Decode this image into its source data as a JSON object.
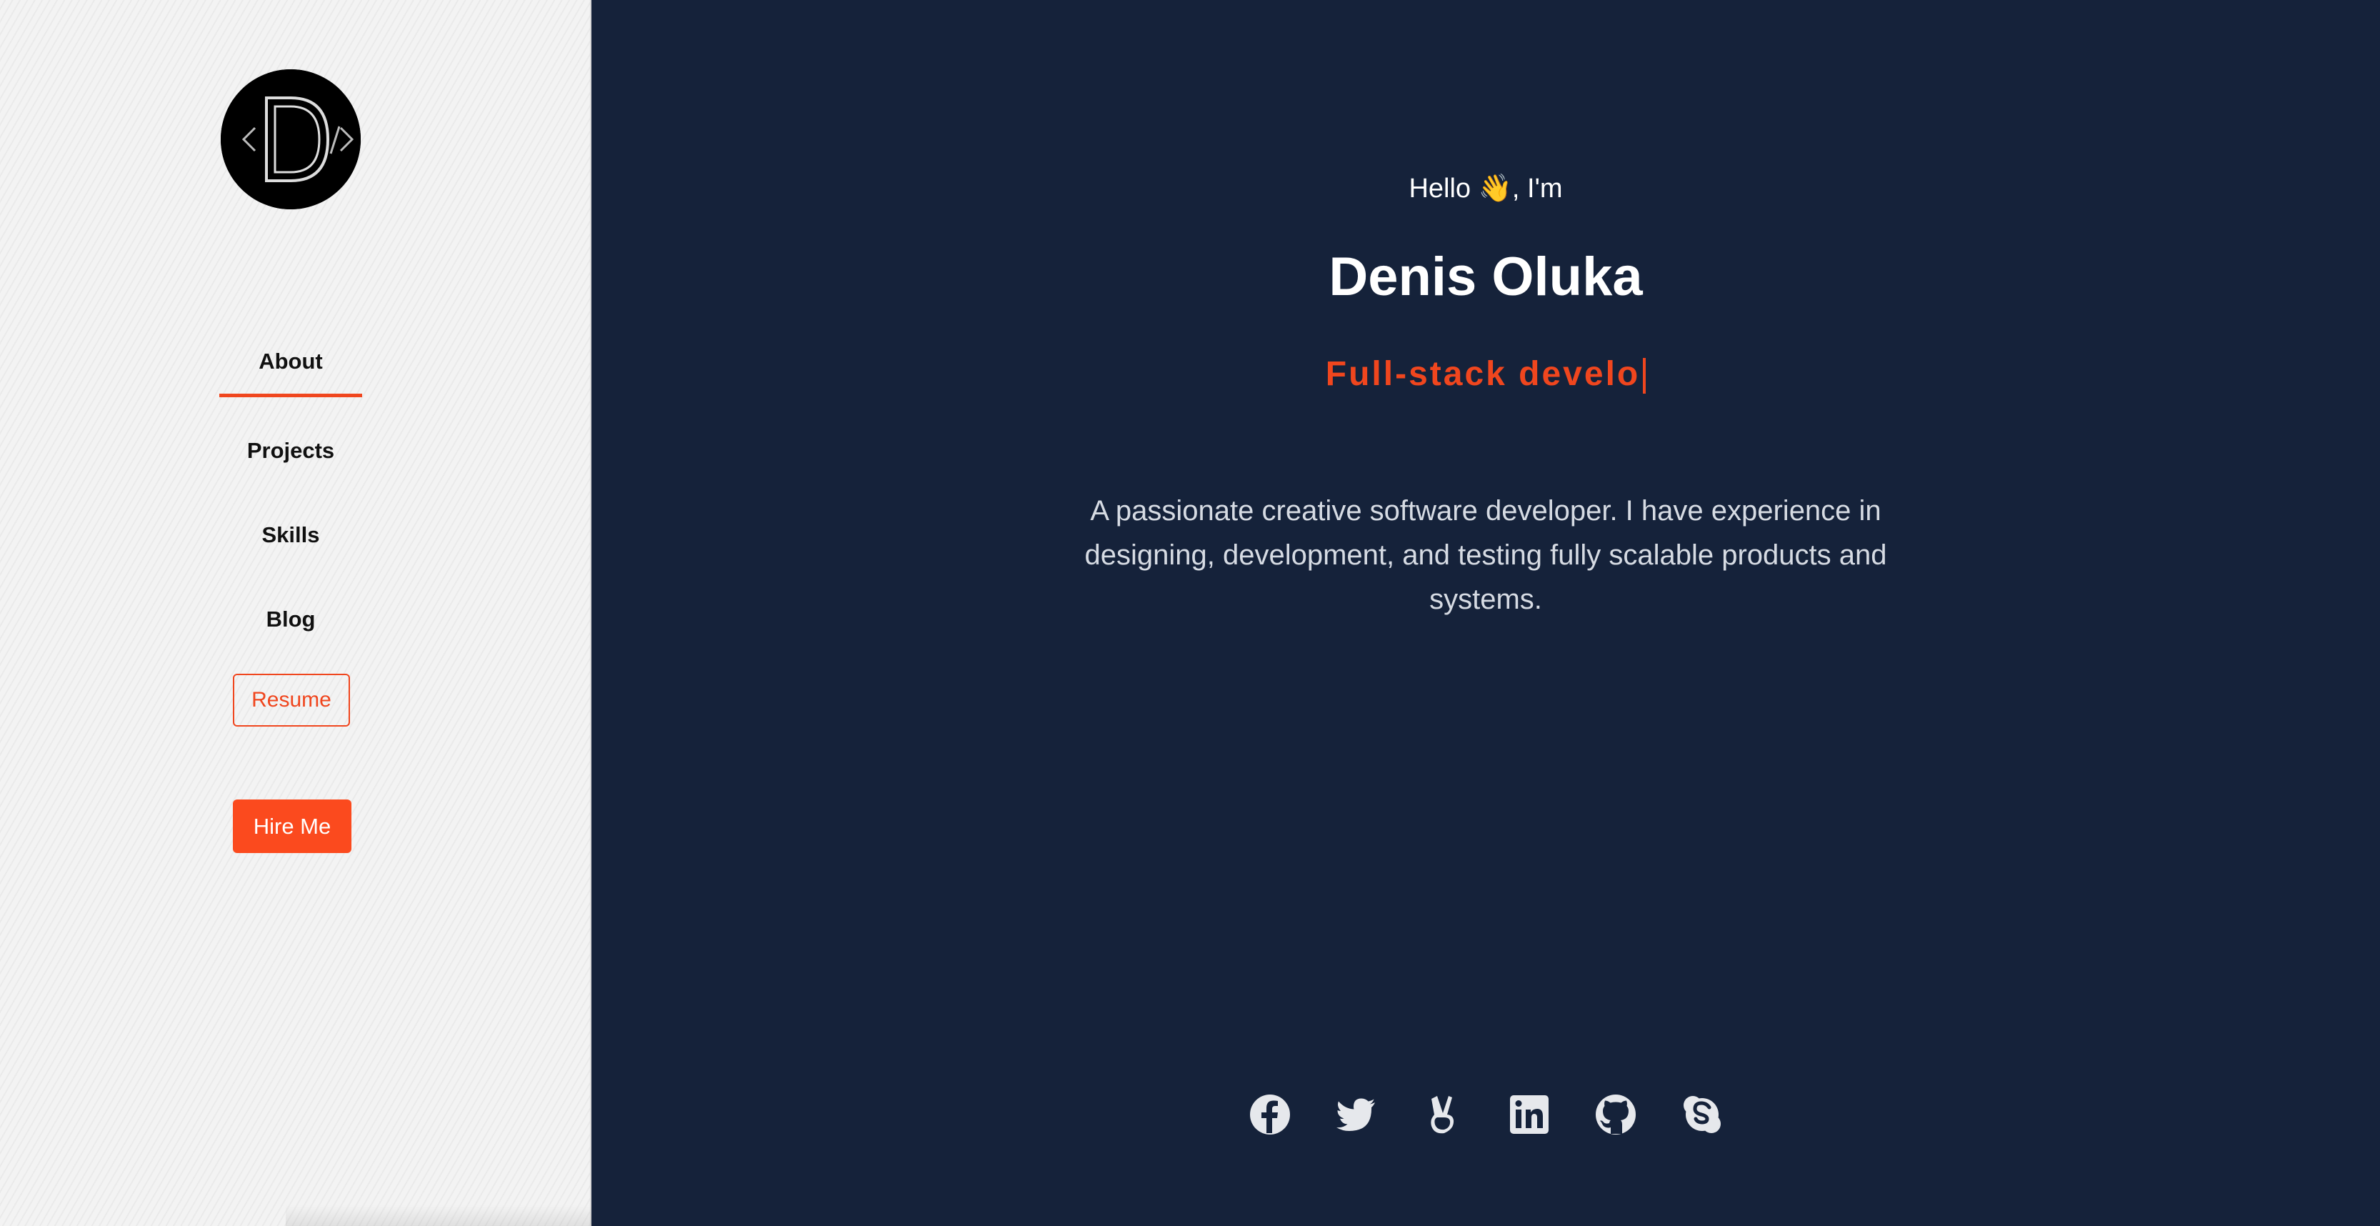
{
  "sidebar": {
    "logo": {
      "icon": "logo-d-code-icon"
    },
    "nav": [
      {
        "label": "About",
        "active": true
      },
      {
        "label": "Projects"
      },
      {
        "label": "Skills"
      },
      {
        "label": "Blog"
      }
    ],
    "resume_label": "Resume",
    "hire_label": "Hire Me"
  },
  "hero": {
    "greeting": "Hello 👋, I'm",
    "name": "Denis Oluka",
    "role_typed": "Full-stack develo",
    "bio": "A passionate creative software developer. I have experience in designing, development, and testing fully scalable products and systems."
  },
  "socials": [
    {
      "icon": "facebook-icon"
    },
    {
      "icon": "twitter-icon"
    },
    {
      "icon": "angellist-icon"
    },
    {
      "icon": "linkedin-icon"
    },
    {
      "icon": "github-icon"
    },
    {
      "icon": "skype-icon"
    }
  ],
  "colors": {
    "accent": "#f0461e",
    "main_bg": "#15223a",
    "sidebar_bg": "#f3f3f3"
  }
}
